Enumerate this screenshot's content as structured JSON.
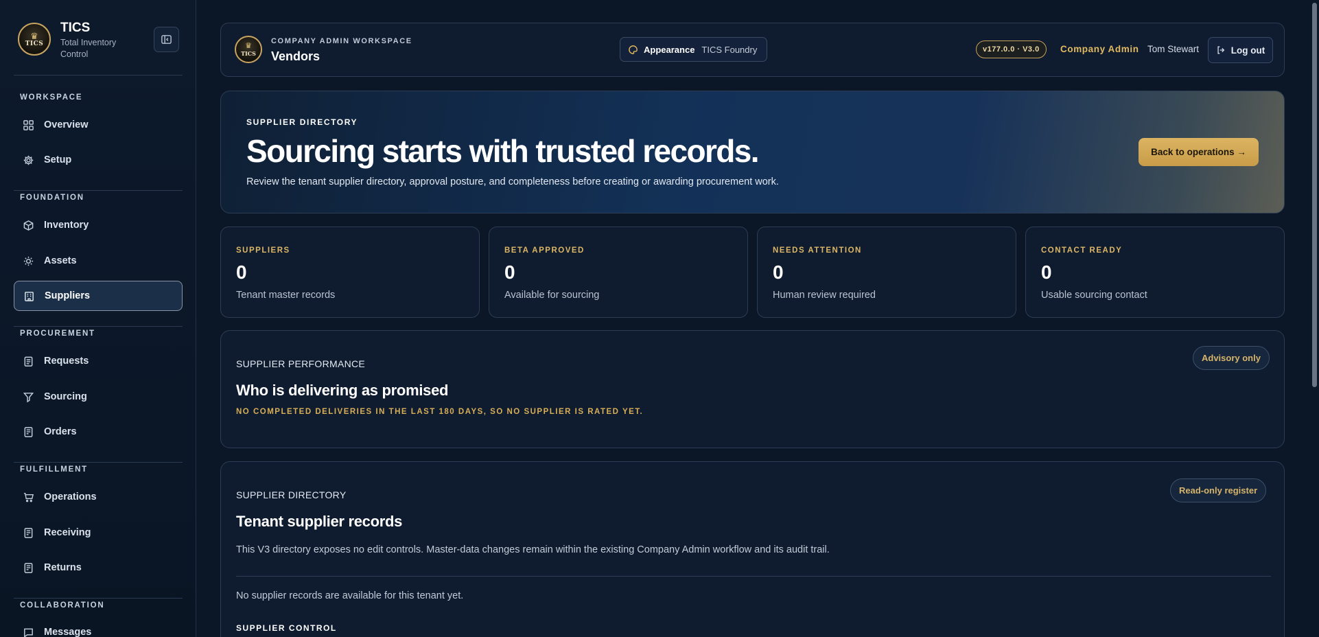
{
  "sidebar": {
    "brand_name": "TICS",
    "brand_subtitle": "Total Inventory Control",
    "logo_text": "TICS",
    "sections": [
      {
        "heading": "WORKSPACE",
        "items": [
          {
            "label": "Overview",
            "icon": "grid-icon"
          },
          {
            "label": "Setup",
            "icon": "gear-icon"
          }
        ]
      },
      {
        "heading": "FOUNDATION",
        "items": [
          {
            "label": "Inventory",
            "icon": "box-icon"
          },
          {
            "label": "Assets",
            "icon": "sun-icon"
          },
          {
            "label": "Suppliers",
            "icon": "building-icon",
            "active": true
          }
        ]
      },
      {
        "heading": "PROCUREMENT",
        "items": [
          {
            "label": "Requests",
            "icon": "clipboard-icon"
          },
          {
            "label": "Sourcing",
            "icon": "funnel-icon"
          },
          {
            "label": "Orders",
            "icon": "receipt-icon"
          }
        ]
      },
      {
        "heading": "FULFILLMENT",
        "items": [
          {
            "label": "Operations",
            "icon": "cart-icon"
          },
          {
            "label": "Receiving",
            "icon": "receipt-icon"
          },
          {
            "label": "Returns",
            "icon": "receipt-icon"
          }
        ]
      },
      {
        "heading": "COLLABORATION",
        "items": [
          {
            "label": "Messages",
            "icon": "message-icon"
          }
        ]
      }
    ]
  },
  "header": {
    "eyebrow": "COMPANY ADMIN WORKSPACE",
    "title": "Vendors",
    "appearance_label": "Appearance",
    "appearance_value": "TICS Foundry",
    "version": "v177.0.0 · V3.0",
    "role": "Company Admin",
    "user": "Tom Stewart",
    "logout_label": "Log out"
  },
  "hero": {
    "eyebrow": "SUPPLIER DIRECTORY",
    "title": "Sourcing starts with trusted records.",
    "subtitle": "Review the tenant supplier directory, approval posture, and completeness before creating or awarding procurement work.",
    "button": "Back to operations →"
  },
  "stats": [
    {
      "label": "SUPPLIERS",
      "value": "0",
      "desc": "Tenant master records"
    },
    {
      "label": "BETA APPROVED",
      "value": "0",
      "desc": "Available for sourcing"
    },
    {
      "label": "NEEDS ATTENTION",
      "value": "0",
      "desc": "Human review required"
    },
    {
      "label": "CONTACT READY",
      "value": "0",
      "desc": "Usable sourcing contact"
    }
  ],
  "performance": {
    "eyebrow": "SUPPLIER PERFORMANCE",
    "title": "Who is delivering as promised",
    "pill": "Advisory only",
    "note": "NO COMPLETED DELIVERIES IN THE LAST 180 DAYS, SO NO SUPPLIER IS RATED YET."
  },
  "directory": {
    "eyebrow": "SUPPLIER DIRECTORY",
    "title": "Tenant supplier records",
    "pill": "Read-only register",
    "description": "This V3 directory exposes no edit controls. Master-data changes remain within the existing Company Admin workflow and its audit trail.",
    "empty": "No supplier records are available for this tenant yet.",
    "control_heading": "SUPPLIER CONTROL"
  },
  "colors": {
    "accent_gold": "#ddb664",
    "background": "#0b1626",
    "panel": "#0f1c2f"
  }
}
